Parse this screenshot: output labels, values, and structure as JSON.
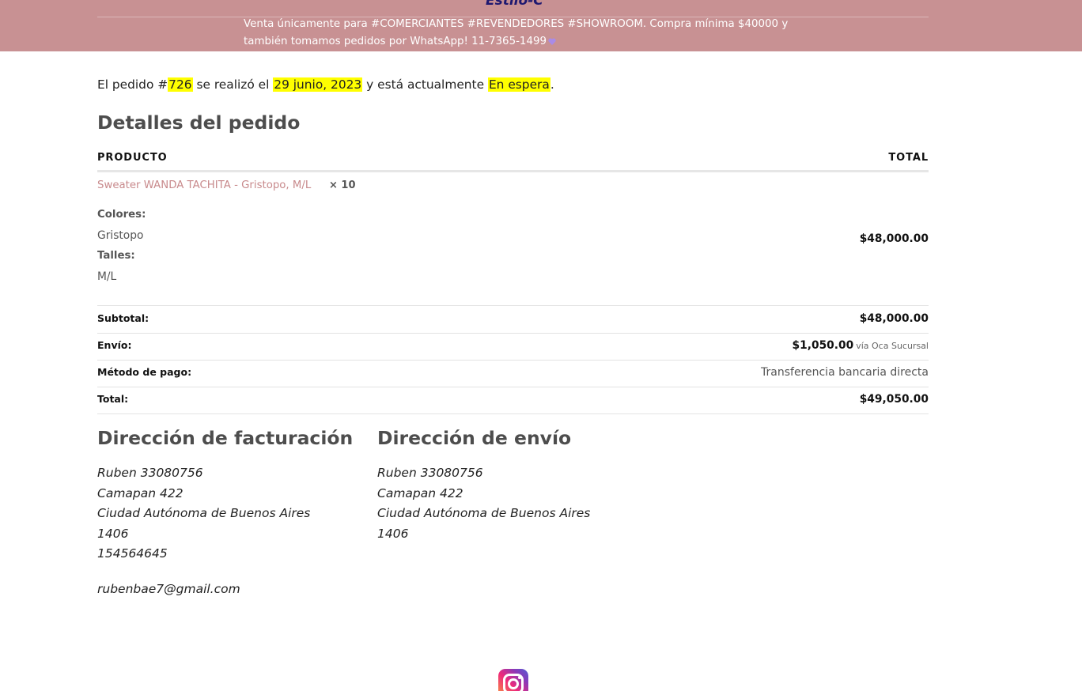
{
  "header": {
    "brand": "Estilo-C",
    "announcement": "Venta únicamente para #COMERCIANTES #REVENDEDORES #SHOWROOM. Compra mínima $40000 y también tomamos pedidos por WhatsApp! 11-7365-1499",
    "announcement_icon": "purple-heart-icon",
    "background_color": "#c89193"
  },
  "order_notice": {
    "prefix": "El pedido #",
    "order_number": "726",
    "middle": " se realizó el ",
    "date": "29 junio, 2023",
    "middle2": " y está actualmente ",
    "status": "En espera",
    "suffix": "."
  },
  "order_details": {
    "heading": "Detalles del pedido",
    "col_product": "PRODUCTO",
    "col_total": "TOTAL",
    "items": [
      {
        "name": "Sweater WANDA TACHITA - Gristopo, M/L",
        "quantity": "× 10",
        "meta": [
          {
            "label": "Colores:",
            "value": "Gristopo"
          },
          {
            "label": "Talles:",
            "value": "M/L"
          }
        ],
        "total": "$48,000.00"
      }
    ],
    "totals": [
      {
        "label": "Subtotal:",
        "value": "$48,000.00",
        "note": ""
      },
      {
        "label": "Envío:",
        "value": "$1,050.00",
        "note": "vía Oca Sucursal"
      },
      {
        "label": "Método de pago:",
        "value": "Transferencia bancaria directa",
        "note": ""
      },
      {
        "label": "Total:",
        "value": "$49,050.00",
        "note": ""
      }
    ],
    "link_color": "#c88a8c",
    "highlight_color": "#ffff00"
  },
  "billing": {
    "heading": "Dirección de facturación",
    "lines": [
      "Ruben 33080756",
      "Camapan 422",
      "Ciudad Autónoma de Buenos Aires",
      "1406",
      "154564645"
    ],
    "email": "rubenbae7@gmail.com"
  },
  "shipping": {
    "heading": "Dirección de envío",
    "lines": [
      "Ruben 33080756",
      "Camapan 422",
      "Ciudad Autónoma de Buenos Aires",
      "1406"
    ]
  },
  "footer": {
    "social_icon": "instagram-icon"
  }
}
